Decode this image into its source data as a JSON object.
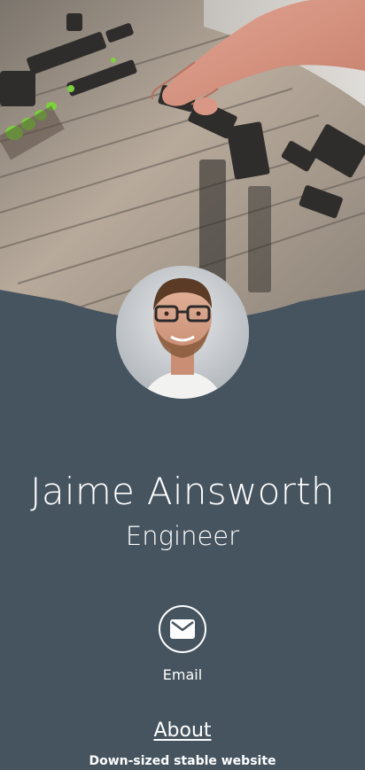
{
  "profile": {
    "name": "Jaime Ainsworth",
    "title": "Engineer"
  },
  "contact": {
    "email_label": "Email",
    "email_icon": "envelope-icon"
  },
  "about": {
    "link_label": "About",
    "text": "Down-sized stable website"
  },
  "colors": {
    "background": "#46545f",
    "text": "#ffffff"
  }
}
